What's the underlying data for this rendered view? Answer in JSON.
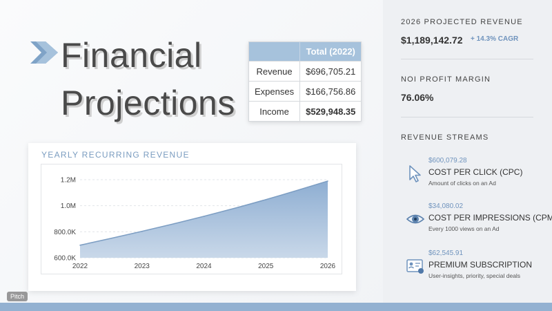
{
  "slide": {
    "title_line1": "Financial",
    "title_line2": "Projections"
  },
  "summary_table": {
    "header": "Total (2022)",
    "rows": [
      {
        "label": "Revenue",
        "value": "$696,705.21"
      },
      {
        "label": "Expenses",
        "value": "$166,756.86"
      },
      {
        "label": "Income",
        "value": "$529,948.35"
      }
    ]
  },
  "chart_card": {
    "title": "YEARLY RECURRING REVENUE"
  },
  "chart_data": {
    "type": "area",
    "x": [
      "2022",
      "2023",
      "2024",
      "2025",
      "2026"
    ],
    "series": [
      {
        "values": [
          696705,
          802000,
          917000,
          1045000,
          1189143
        ]
      }
    ],
    "y_ticks": [
      "600.0K",
      "800.0K",
      "1.0M",
      "1.2M"
    ],
    "y_tick_values": [
      600000,
      800000,
      1000000,
      1200000
    ],
    "ylim": [
      600000,
      1200000
    ],
    "grid": true,
    "fill_color": "#a3bedb",
    "line_color": "#7d9ec3"
  },
  "sidebar": {
    "projected": {
      "label": "2026 PROJECTED REVENUE",
      "value": "$1,189,142.72",
      "cagr": "+ 14.3% CAGR"
    },
    "noi": {
      "label": "NOI PROFIT MARGIN",
      "value": "76.06%"
    },
    "streams_label": "REVENUE STREAMS",
    "streams": [
      {
        "amount": "$600,079.28",
        "title": "COST PER CLICK (CPC)",
        "desc": "Amount of clicks on an Ad",
        "icon": "cursor-icon"
      },
      {
        "amount": "$34,080.02",
        "title": "COST PER IMPRESSIONS (CPM)",
        "desc": "Every 1000 views on an Ad",
        "icon": "eye-icon"
      },
      {
        "amount": "$62,545.91",
        "title": "PREMIUM SUBSCRIPTION",
        "desc": "User-insights, priority, special deals",
        "icon": "certificate-icon"
      }
    ]
  },
  "badge": {
    "label": "Pitch"
  },
  "colors": {
    "accent": "#7a9cc0",
    "table_header": "#a6c2dc",
    "bottom_strip": "#93b1d1"
  }
}
